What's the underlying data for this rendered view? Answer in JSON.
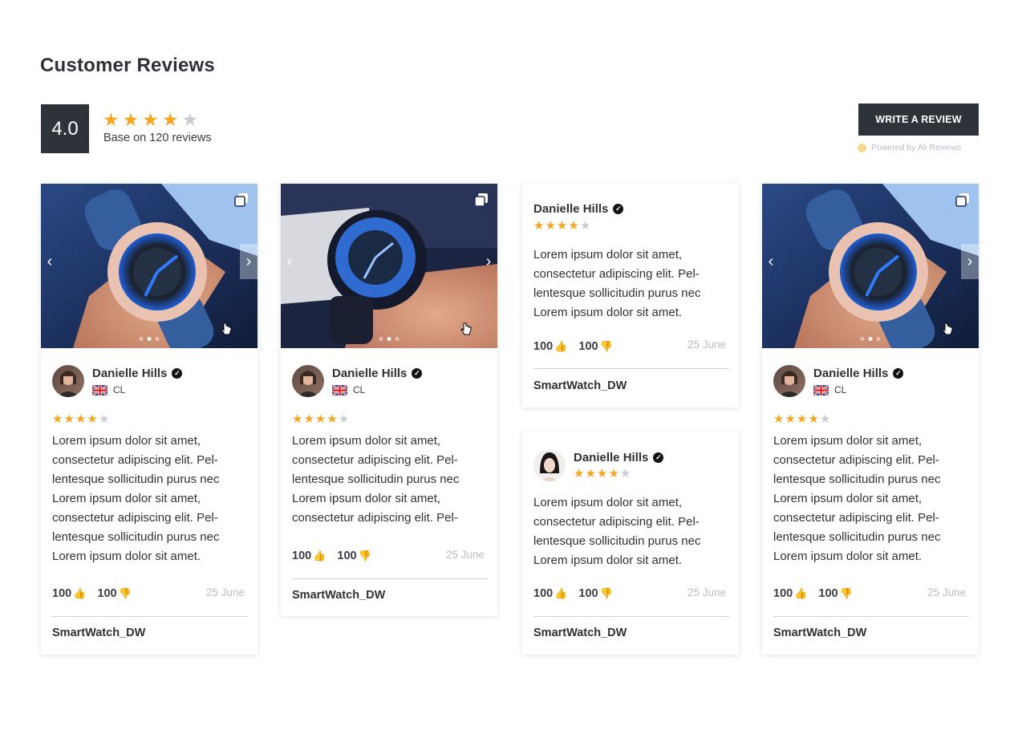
{
  "page": {
    "title": "Customer Reviews"
  },
  "summary": {
    "score": "4.0",
    "stars": [
      "gold",
      "gold",
      "gold",
      "gold",
      "grey"
    ],
    "caption": "Base on 120 reviews",
    "write_button": "WRITE A REVIEW",
    "powered_by": "Powered by Ali Reviews"
  },
  "colors": {
    "star_filled": "#f5a623",
    "star_empty": "#c7ccd3",
    "dark": "#2e3239"
  },
  "icons": {
    "star": "★",
    "check": "✓",
    "thumb_up": "👍",
    "thumb_down": "👎",
    "prev": "‹",
    "next": "›"
  },
  "reviews": [
    {
      "author": "Danielle Hills",
      "country": "CL",
      "rating": 4,
      "text": [
        "Lorem ipsum dolor sit amet,",
        "consectetur adipiscing elit. Pel-",
        "lentesque sollicitudin purus nec",
        "Lorem ipsum dolor sit amet,",
        "consectetur adipiscing elit. Pel-",
        "lentesque sollicitudin purus nec",
        "Lorem ipsum dolor sit amet."
      ],
      "likes": "100",
      "dislikes": "100",
      "date": "25 June",
      "product": "SmartWatch_DW"
    },
    {
      "author": "Danielle Hills",
      "country": "CL",
      "rating": 4,
      "text": [
        "Lorem ipsum dolor sit amet,",
        "consectetur adipiscing elit. Pel-",
        "lentesque sollicitudin purus nec",
        "Lorem ipsum dolor sit amet,",
        "consectetur adipiscing elit. Pel-"
      ],
      "likes": "100",
      "dislikes": "100",
      "date": "25 June",
      "product": "SmartWatch_DW"
    },
    {
      "author": "Danielle Hills",
      "rating": 4,
      "text": [
        "Lorem ipsum dolor sit amet,",
        "consectetur adipiscing elit. Pel-",
        "lentesque sollicitudin purus nec",
        "Lorem ipsum dolor sit amet."
      ],
      "likes": "100",
      "dislikes": "100",
      "date": "25 June",
      "product": "SmartWatch_DW"
    },
    {
      "author": "Danielle Hills",
      "rating": 4,
      "text": [
        "Lorem ipsum dolor sit amet,",
        "consectetur adipiscing elit. Pel-",
        "lentesque sollicitudin purus nec",
        "Lorem ipsum dolor sit amet."
      ],
      "likes": "100",
      "dislikes": "100",
      "date": "25 June",
      "product": "SmartWatch_DW"
    },
    {
      "author": "Danielle Hills",
      "country": "CL",
      "rating": 4,
      "text": [
        "Lorem ipsum dolor sit amet,",
        "consectetur adipiscing elit. Pel-",
        "lentesque sollicitudin purus nec",
        "Lorem ipsum dolor sit amet,",
        "consectetur adipiscing elit. Pel-",
        "lentesque sollicitudin purus nec",
        "Lorem ipsum dolor sit amet."
      ],
      "likes": "100",
      "dislikes": "100",
      "date": "25 June",
      "product": "SmartWatch_DW"
    }
  ]
}
